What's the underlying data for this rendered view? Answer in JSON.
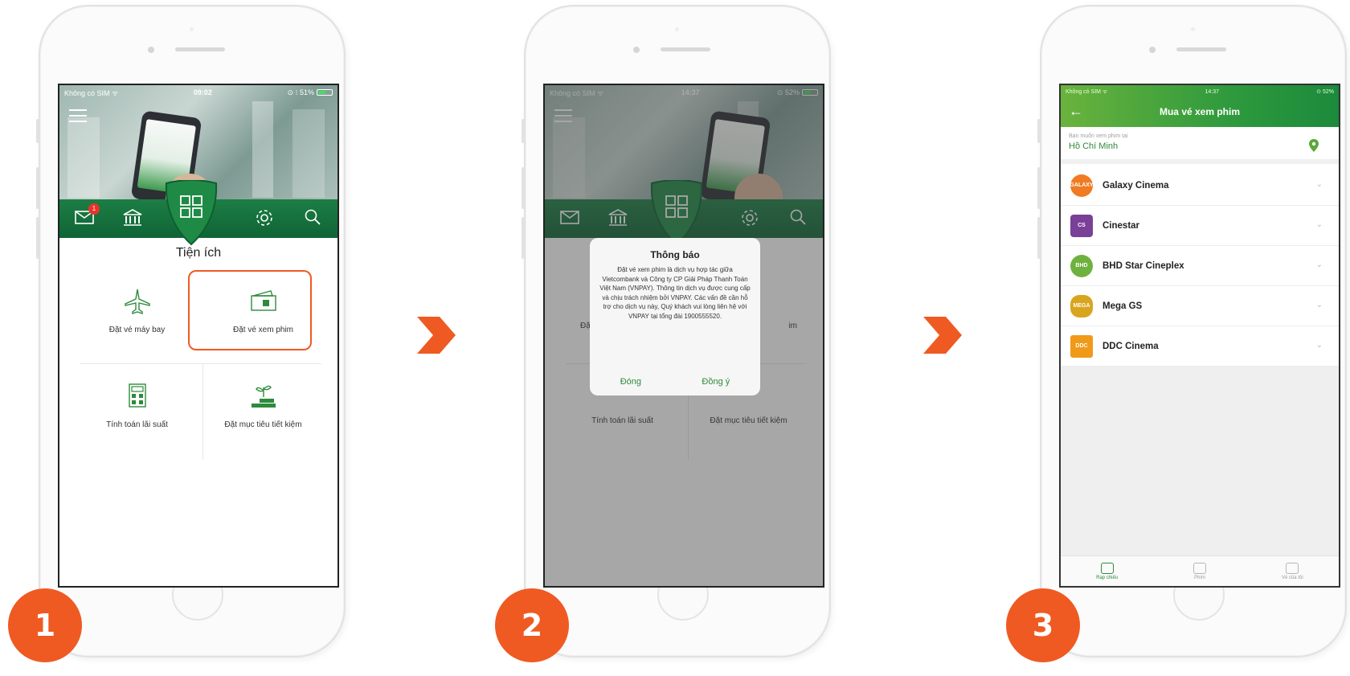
{
  "steps": [
    "1",
    "2",
    "3"
  ],
  "colors": {
    "accent": "#ef5a22",
    "brand_green": "#2e8b3c",
    "nav_green": "#1d7e45"
  },
  "screen1": {
    "status_left": "Không có SIM ᯤ",
    "status_time": "09:02",
    "status_right": "⊙ ⁝ 51%",
    "notification_count": "1",
    "section_title": "Tiện ích",
    "items": [
      {
        "label": "Đặt vé máy bay",
        "icon": "airplane-icon"
      },
      {
        "label": "Đặt vé xem phim",
        "icon": "ticket-icon"
      },
      {
        "label": "Tính toán lãi suất",
        "icon": "calculator-icon"
      },
      {
        "label": "Đặt mục tiêu tiết kiệm",
        "icon": "savings-goal-icon"
      }
    ]
  },
  "screen2": {
    "status_left": "Không có SIM ᯤ",
    "status_time": "14:37",
    "status_right": "⊙ 52%",
    "section_title": "Tiện ích",
    "bg_items": [
      "Đặ",
      "im",
      "Tính toán lãi suất",
      "Đặt mục tiêu tiết kiệm"
    ],
    "dialog_title": "Thông báo",
    "dialog_body": "Đặt vé xem phim là dịch vụ hợp tác giữa Vietcombank và Công ty CP Giải Pháp Thanh Toán Việt Nam (VNPAY). Thông tin dịch vụ được cung cấp và chịu trách nhiệm bởi VNPAY. Các vấn đề cần hỗ trợ cho dịch vụ này, Quý khách vui lòng liên hệ với VNPAY tại tổng đài 1900555520.",
    "btn_close": "Đóng",
    "btn_agree": "Đồng ý"
  },
  "screen3": {
    "status_left": "Không có SIM ᯤ",
    "status_time": "14:37",
    "status_right": "⊙ 52%",
    "title": "Mua vé xem phim",
    "loc_hint": "Bạn muốn xem phim tại",
    "city": "Hồ Chí Minh",
    "cinemas": [
      {
        "name": "Galaxy Cinema",
        "color": "#f07b22",
        "logo_text": "GALAXY"
      },
      {
        "name": "Cinestar",
        "color": "#7a3f96",
        "logo_text": "CS"
      },
      {
        "name": "BHD Star Cineplex",
        "color": "#6fb13f",
        "logo_text": "BHD"
      },
      {
        "name": "Mega GS",
        "color": "#d9a51f",
        "logo_text": "MEGA"
      },
      {
        "name": "DDC Cinema",
        "color": "#f09a1a",
        "logo_text": "DDC"
      }
    ],
    "tabs": [
      "Rạp chiếu",
      "Phim",
      "Vé của tôi"
    ]
  }
}
